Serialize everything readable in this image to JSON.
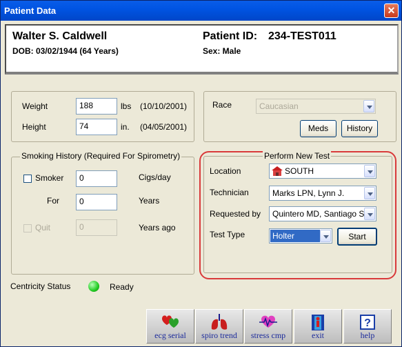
{
  "window": {
    "title": "Patient Data",
    "close": "✕"
  },
  "patient": {
    "name": "Walter S. Caldwell",
    "dob": "DOB:  03/02/1944 (64 Years)",
    "id_label": "Patient ID:",
    "id_value": "234-TEST011",
    "sex": "Sex: Male"
  },
  "vitals": {
    "weight_label": "Weight",
    "weight_value": "188",
    "weight_unit": "lbs",
    "weight_date": "(10/10/2001)",
    "height_label": "Height",
    "height_value": "74",
    "height_unit": "in.",
    "height_date": "(04/05/2001)"
  },
  "race": {
    "label": "Race",
    "value": "Caucasian",
    "meds_button": "Meds",
    "history_button": "History"
  },
  "smoking": {
    "title": "Smoking History (Required For Spirometry)",
    "smoker_label": "Smoker",
    "smoker_checked": false,
    "cigs_value": "0",
    "cigs_unit": "Cigs/day",
    "for_label": "For",
    "years_value": "0",
    "years_unit": "Years",
    "quit_label": "Quit",
    "quit_value": "0",
    "quit_unit": "Years ago"
  },
  "new_test": {
    "title": "Perform New Test",
    "location_label": "Location",
    "location_value": "SOUTH",
    "technician_label": "Technician",
    "technician_value": "Marks LPN, Lynn J.",
    "requested_label": "Requested by",
    "requested_value": "Quintero MD, Santiago S",
    "test_type_label": "Test Type",
    "test_type_value": "Holter",
    "start_button": "Start"
  },
  "status": {
    "label": "Centricity Status",
    "value": "Ready",
    "color": "#22cc22"
  },
  "toolbar": [
    {
      "label": "ecg serial",
      "icon": "hearts-icon"
    },
    {
      "label": "spiro trend",
      "icon": "lungs-icon"
    },
    {
      "label": "stress cmp",
      "icon": "stress-heart-icon"
    },
    {
      "label": "exit",
      "icon": "exit-door-icon"
    },
    {
      "label": "help",
      "icon": "help-icon"
    }
  ]
}
